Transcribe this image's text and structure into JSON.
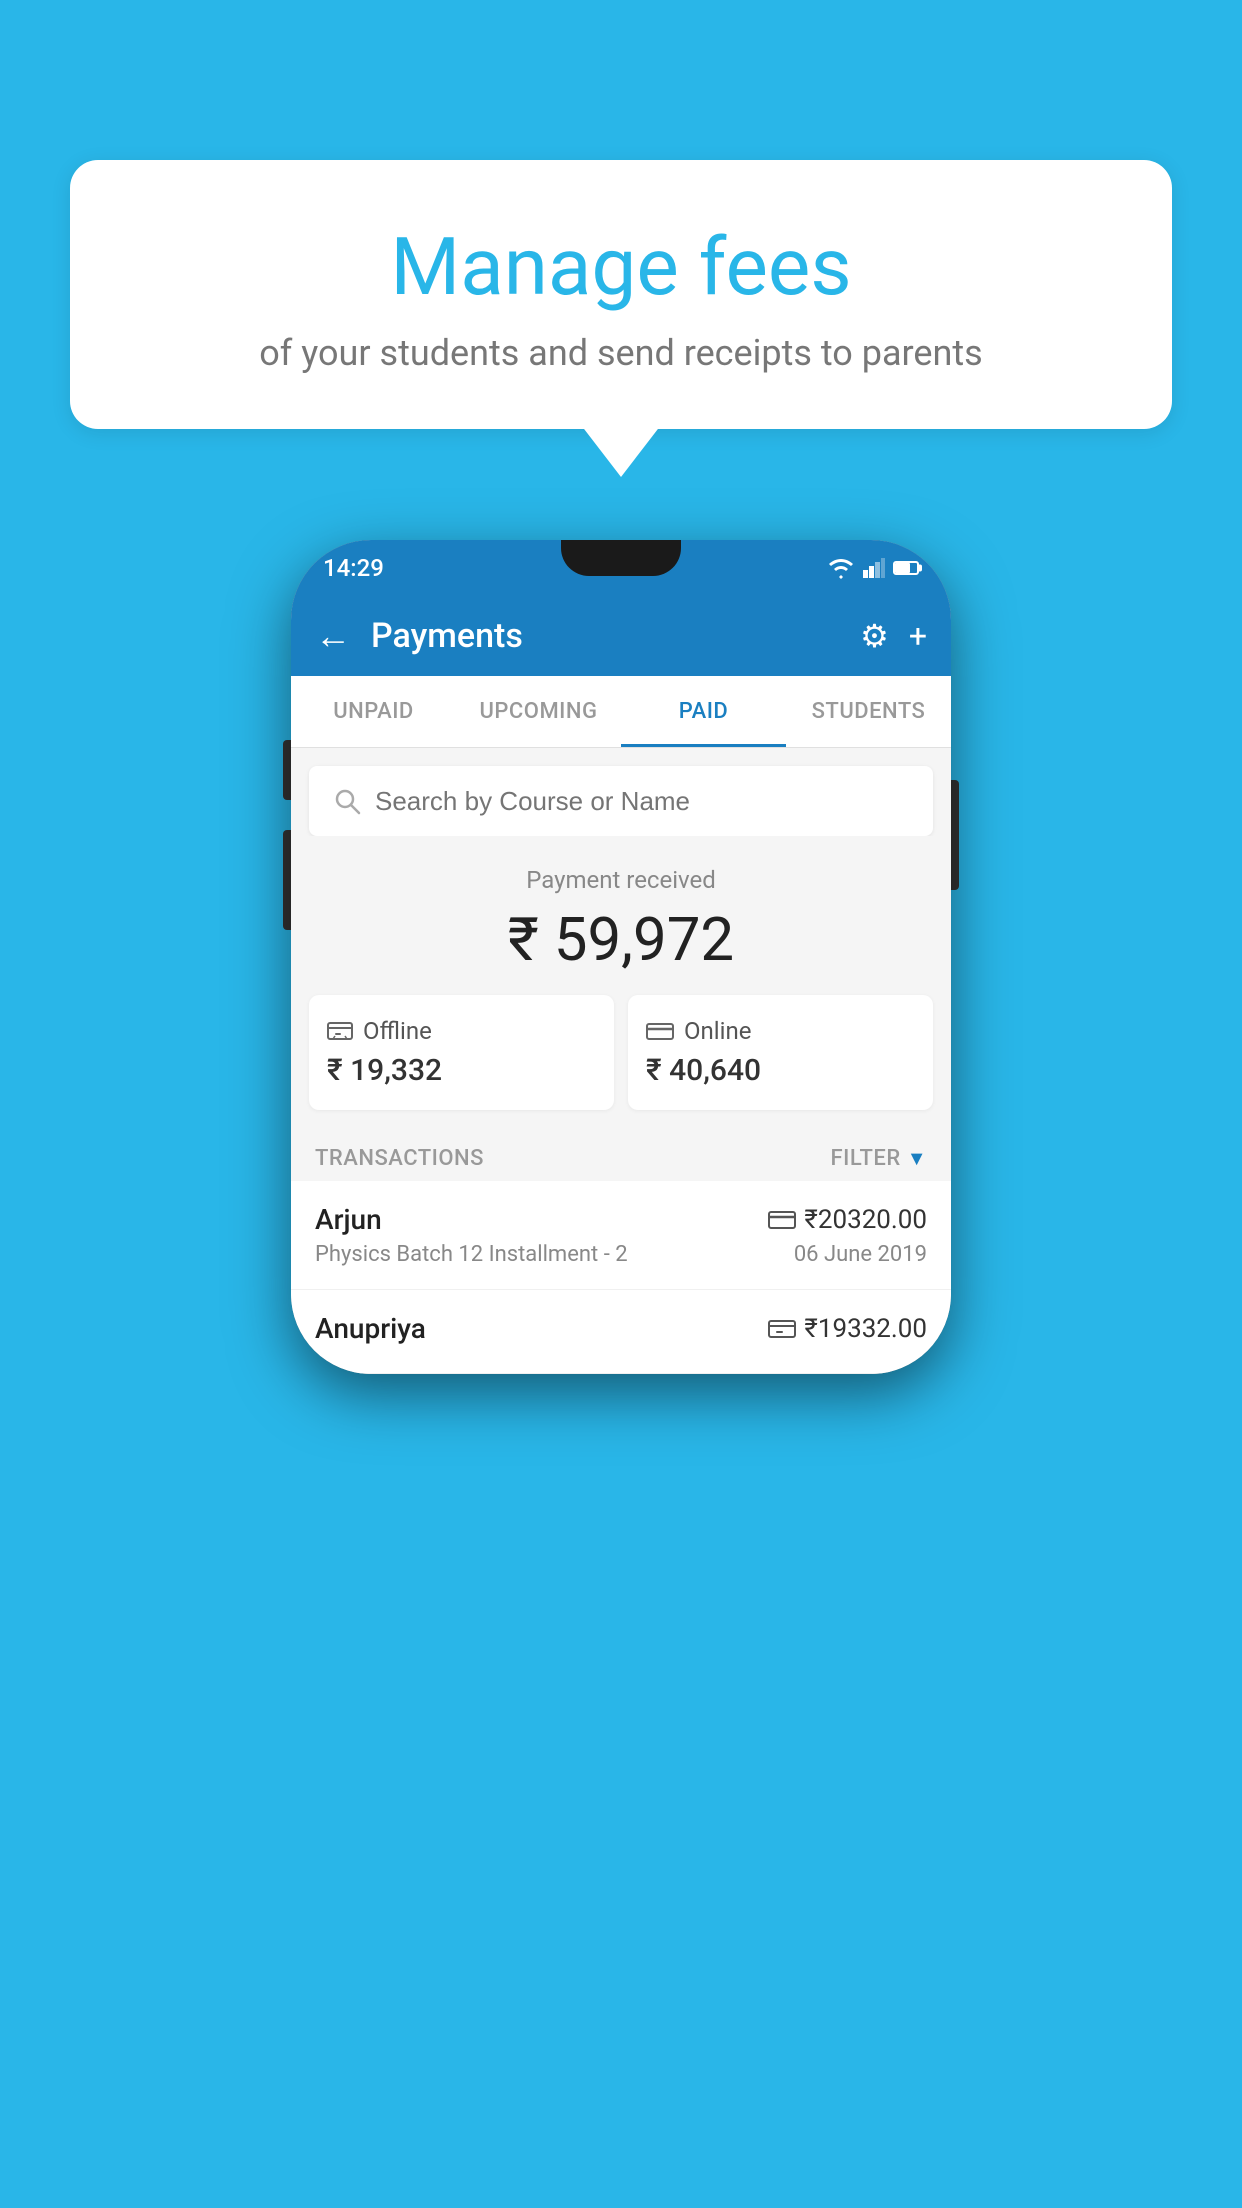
{
  "page": {
    "background_color": "#29b6e8"
  },
  "speech_bubble": {
    "title": "Manage fees",
    "subtitle": "of your students and send receipts to parents"
  },
  "phone": {
    "status_bar": {
      "time": "14:29"
    },
    "app_bar": {
      "title": "Payments",
      "back_label": "←",
      "settings_label": "⚙",
      "add_label": "+"
    },
    "tabs": [
      {
        "label": "UNPAID",
        "active": false
      },
      {
        "label": "UPCOMING",
        "active": false
      },
      {
        "label": "PAID",
        "active": true
      },
      {
        "label": "STUDENTS",
        "active": false
      }
    ],
    "search": {
      "placeholder": "Search by Course or Name"
    },
    "summary": {
      "received_label": "Payment received",
      "total_amount": "₹ 59,972",
      "offline_label": "Offline",
      "offline_amount": "₹ 19,332",
      "online_label": "Online",
      "online_amount": "₹ 40,640"
    },
    "transactions": {
      "header_label": "TRANSACTIONS",
      "filter_label": "FILTER",
      "rows": [
        {
          "name": "Arjun",
          "course": "Physics Batch 12 Installment - 2",
          "amount": "₹20320.00",
          "date": "06 June 2019",
          "payment_type": "online"
        },
        {
          "name": "Anupriya",
          "course": "",
          "amount": "₹19332.00",
          "date": "",
          "payment_type": "offline"
        }
      ]
    }
  }
}
